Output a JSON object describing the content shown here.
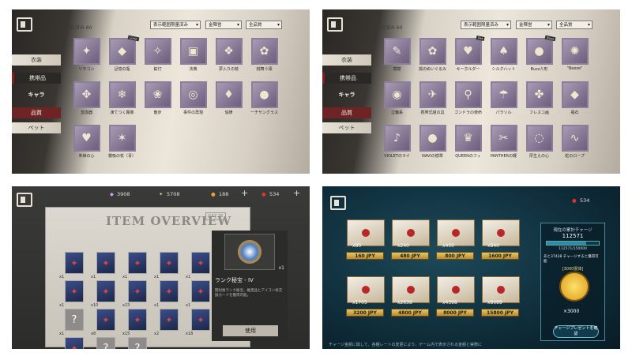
{
  "panel1": {
    "owned": "所有済み 60",
    "filters": [
      "表示範囲限量済み",
      "金陣営",
      "全品質"
    ],
    "sidebar": [
      "衣装",
      "携帯品",
      "キャラ",
      "品質",
      "ペット"
    ],
    "items": [
      {
        "label": "リモコン",
        "icon": "✦"
      },
      {
        "label": "記憶の瓶",
        "icon": "◆",
        "tag": "Limit"
      },
      {
        "label": "鉱灯",
        "icon": "✧"
      },
      {
        "label": "法典",
        "icon": "▣"
      },
      {
        "label": "夢入りの枝",
        "icon": "❖"
      },
      {
        "label": "桃舞う頭",
        "icon": "✿"
      },
      {
        "label": "変換器",
        "icon": "✥"
      },
      {
        "label": "凍てつく霧車",
        "icon": "❄"
      },
      {
        "label": "散步",
        "icon": "❀"
      },
      {
        "label": "事件の再現",
        "icon": "◎"
      },
      {
        "label": "協律",
        "icon": "♦"
      },
      {
        "label": "一チサングラス",
        "icon": "●"
      },
      {
        "label": "朱禅の心",
        "icon": "♥"
      },
      {
        "label": "霧吸の杖（青）",
        "icon": "✶"
      }
    ]
  },
  "panel2": {
    "owned": "所有済み 60",
    "filters": [
      "表示範囲限量済み",
      "金陣営",
      "全品質"
    ],
    "sidebar": [
      "衣装",
      "携帯品",
      "キャラ",
      "品質",
      "ペット"
    ],
    "items": [
      {
        "label": "樹樹",
        "icon": "✎"
      },
      {
        "label": "狐のぬいぐるみ",
        "icon": "✿"
      },
      {
        "label": "キーホルダー",
        "icon": "♥",
        "tag": "Pet"
      },
      {
        "label": "シルクハット",
        "icon": "♠"
      },
      {
        "label": "Buzz人形",
        "icon": "●",
        "tag": "Buzz"
      },
      {
        "label": "\"Beeze\"",
        "icon": "✺"
      },
      {
        "label": "泣輪系",
        "icon": "◉"
      },
      {
        "label": "携帯式組の具",
        "icon": "✈"
      },
      {
        "label": "ゴンドラの使命",
        "icon": "⚲"
      },
      {
        "label": "パラソル",
        "icon": "☂"
      },
      {
        "label": "フレスコ画",
        "icon": "✤"
      },
      {
        "label": "瓶石",
        "icon": "◆"
      },
      {
        "label": "VIOLETのライ",
        "icon": "♪"
      },
      {
        "label": "NAVIの樹準",
        "icon": "●"
      },
      {
        "label": "QUEENのフィ",
        "icon": "♛"
      },
      {
        "label": "PANTHERの鞭",
        "icon": "✂"
      },
      {
        "label": "厚生えの心",
        "icon": "◌"
      },
      {
        "label": "蛇のロープ",
        "icon": "∿"
      }
    ]
  },
  "panel3": {
    "currency": [
      "3908",
      "5708",
      "188",
      "534"
    ],
    "title": "ITEM OVERVIEW",
    "julytag": "JULY 16",
    "tiles": [
      {
        "count": "x1",
        "q": false
      },
      {
        "count": "x1",
        "q": false
      },
      {
        "count": "x1",
        "q": false
      },
      {
        "count": "x1",
        "q": false
      },
      {
        "count": "x1",
        "q": false
      },
      {
        "count": "x1",
        "q": false
      },
      {
        "count": "x1",
        "q": false
      },
      {
        "count": "x10",
        "q": false
      },
      {
        "count": "x23",
        "q": false
      },
      {
        "count": "x1",
        "q": false
      },
      {
        "count": "x1",
        "q": false
      },
      {
        "count": "x1",
        "q": false
      },
      {
        "count": "x1",
        "q": true
      },
      {
        "count": "x8",
        "q": false
      },
      {
        "count": "x15",
        "q": false
      },
      {
        "count": "x2",
        "q": false
      },
      {
        "count": "x18",
        "q": false
      },
      {
        "count": "x1",
        "q": false
      },
      {
        "count": "x1",
        "q": false
      },
      {
        "count": "x1",
        "q": true
      },
      {
        "count": "x1",
        "q": true
      }
    ],
    "detail_qty": "x1",
    "detail_name": "ランク秘宝 - IV",
    "detail_desc": "開封後ランク秘宝。推奨品とアイコン枠交換カードを獲得可能。",
    "use_label": "使用"
  },
  "panel4": {
    "currency": "534",
    "packs": [
      {
        "qty": "x80",
        "price": "160 JPY"
      },
      {
        "qty": "x240",
        "price": "480 JPY"
      },
      {
        "qty": "x400",
        "price": "800 JPY"
      },
      {
        "qty": "x840",
        "price": "1600 JPY"
      },
      {
        "qty": "x1705",
        "price": "3200 JPY"
      },
      {
        "qty": "x2638",
        "price": "4800 JPY"
      },
      {
        "qty": "x4398",
        "price": "8000 JPY"
      },
      {
        "qty": "x8688",
        "price": "15800 JPY"
      }
    ],
    "vip_title": "現在の累計チャージ",
    "vip_value": "112571",
    "vip_progress": "112571/150000",
    "vip_next": "あと37428 チャージすると獲得可能",
    "vip_reward": "[3000霊体]",
    "coin_qty": "×3000",
    "confirm": "チャージプレゼントを確認",
    "footer": "チャージ金額に関して、各種レートの変更により、ゲーム内で表示される金額と実際に"
  }
}
